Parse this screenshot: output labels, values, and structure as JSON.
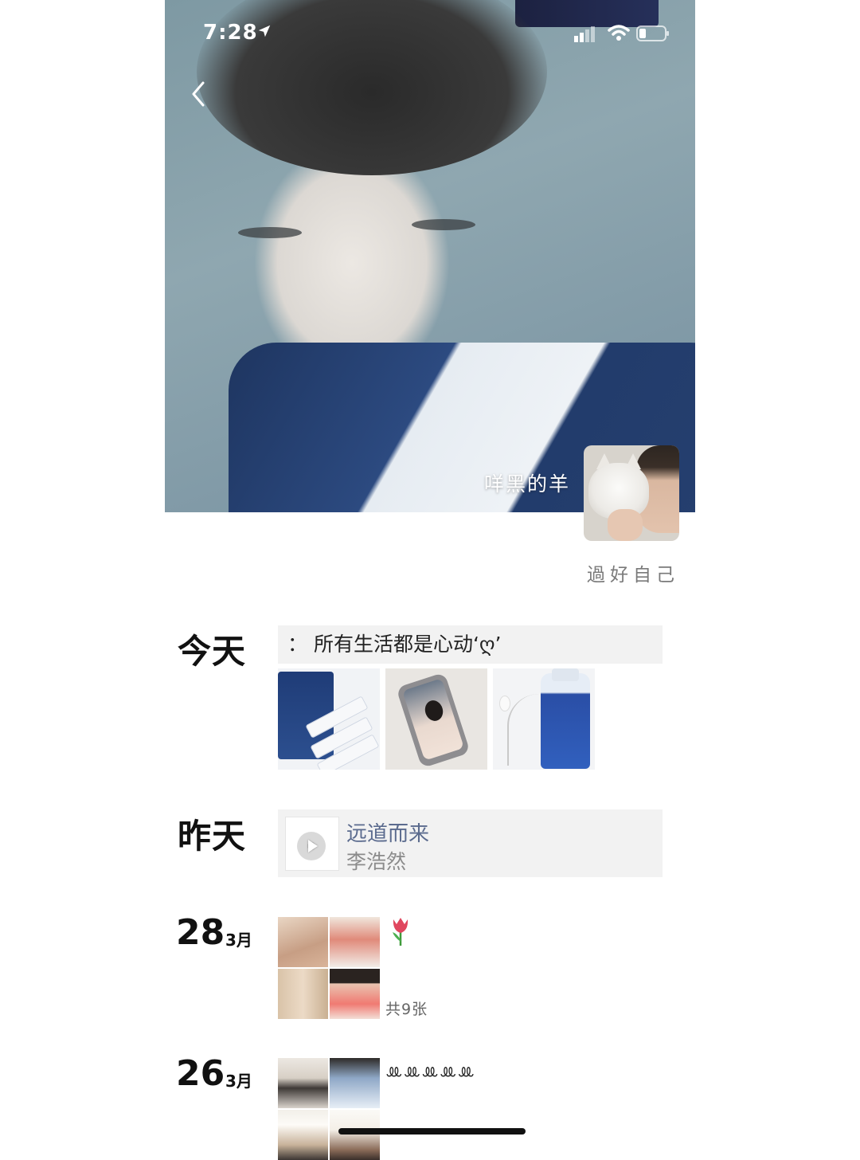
{
  "status_bar": {
    "time": "7:28",
    "icons": [
      "location-arrow-icon",
      "signal-icon",
      "wifi-icon",
      "battery-icon"
    ]
  },
  "nav": {
    "back_icon": "chevron-left-icon"
  },
  "profile": {
    "nickname": "咩黑的羊",
    "signature": "過好自己"
  },
  "feed": {
    "today": {
      "label": "今天",
      "text": "：  所有生活都是心动‘ღ’",
      "photos": [
        "product-photo",
        "phone-selfie-photo",
        "drink-earphones-photo"
      ]
    },
    "yesterday": {
      "label": "昨天",
      "music": {
        "title": "远道而来",
        "artist": "李浩然",
        "icon": "play-icon"
      }
    },
    "mar28": {
      "day": "28",
      "month": "3月",
      "caption_icon": "tulip-icon",
      "photo_count": "共9张"
    },
    "mar26": {
      "day": "26",
      "month": "3月",
      "caption": "ꔛꔛꔛꔛꔛ"
    }
  }
}
